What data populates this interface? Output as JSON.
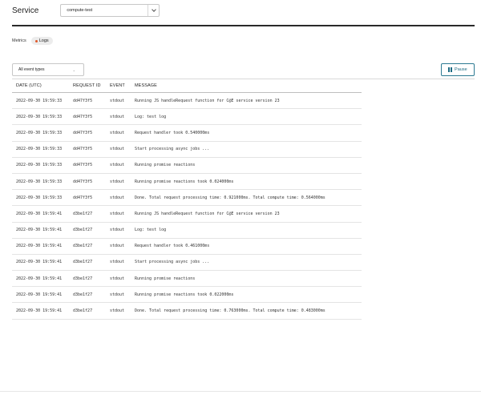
{
  "header": {
    "service_label": "Service",
    "service_value": "compute-test"
  },
  "metrics": {
    "label": "Metrics",
    "logs_pill": "Logs",
    "logs_dot_color": "#e0592a"
  },
  "controls": {
    "event_filter": "All event types",
    "pause_label": "Pause",
    "accent_color": "#1d6a82"
  },
  "table": {
    "headers": [
      "DATE (UTC)",
      "REQUEST ID",
      "EVENT",
      "MESSAGE"
    ],
    "rows": [
      [
        "2022-09-30 19:59:33",
        "dd47f3f5",
        "stdout",
        "Running JS handleRequest function for C@E service version 23"
      ],
      [
        "2022-09-30 19:59:33",
        "dd47f3f5",
        "stdout",
        "Log: test log"
      ],
      [
        "2022-09-30 19:59:33",
        "dd47f3f5",
        "stdout",
        "Request handler took 0.540000ms"
      ],
      [
        "2022-09-30 19:59:33",
        "dd47f3f5",
        "stdout",
        "Start processing async jobs ..."
      ],
      [
        "2022-09-30 19:59:33",
        "dd47f3f5",
        "stdout",
        "Running promise reactions"
      ],
      [
        "2022-09-30 19:59:33",
        "dd47f3f5",
        "stdout",
        "Running promise reactions took 0.024000ms"
      ],
      [
        "2022-09-30 19:59:33",
        "dd47f3f5",
        "stdout",
        "Done. Total request processing time: 0.921000ms. Total compute time: 0.564000ms"
      ],
      [
        "2022-09-30 19:59:41",
        "d3be1f27",
        "stdout",
        "Running JS handleRequest function for C@E service version 23"
      ],
      [
        "2022-09-30 19:59:41",
        "d3be1f27",
        "stdout",
        "Log: test log"
      ],
      [
        "2022-09-30 19:59:41",
        "d3be1f27",
        "stdout",
        "Request handler took 0.461000ms"
      ],
      [
        "2022-09-30 19:59:41",
        "d3be1f27",
        "stdout",
        "Start processing async jobs ..."
      ],
      [
        "2022-09-30 19:59:41",
        "d3be1f27",
        "stdout",
        "Running promise reactions"
      ],
      [
        "2022-09-30 19:59:41",
        "d3be1f27",
        "stdout",
        "Running promise reactions took 0.022000ms"
      ],
      [
        "2022-09-30 19:59:41",
        "d3be1f27",
        "stdout",
        "Done. Total request processing time: 0.763000ms. Total compute time: 0.483000ms"
      ]
    ]
  }
}
